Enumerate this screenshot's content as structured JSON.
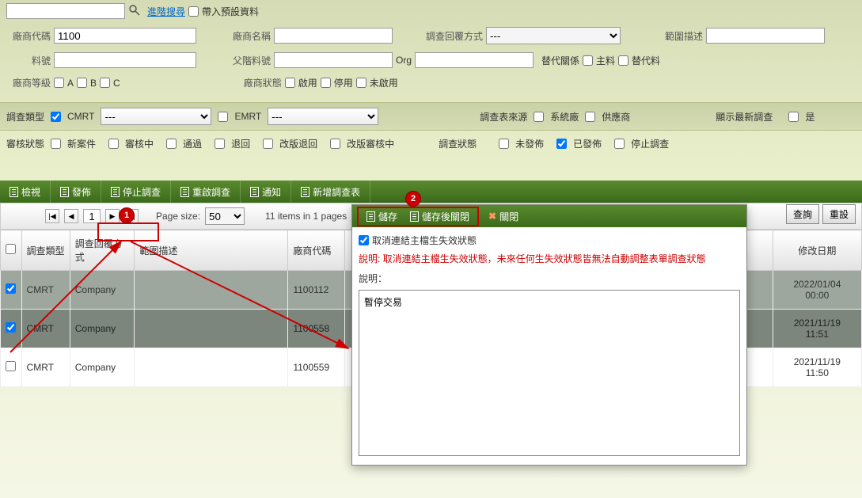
{
  "top": {
    "advanced_search": "進階搜尋",
    "preset_label": "帶入預設資料"
  },
  "form": {
    "vendor_code_lbl": "廠商代碼",
    "vendor_code_val": "1100",
    "vendor_name_lbl": "廠商名稱",
    "reply_method_lbl": "調查回覆方式",
    "reply_method_val": "---",
    "scope_desc_lbl": "範圍描述",
    "part_no_lbl": "料號",
    "parent_part_lbl": "父階料號",
    "org_lbl": "Org",
    "sub_rel_lbl": "替代關係",
    "main_part": "主料",
    "sub_part": "替代料",
    "vendor_grade_lbl": "廠商等級",
    "grade_a": "A",
    "grade_b": "B",
    "grade_c": "C",
    "vendor_status_lbl": "廠商狀態",
    "enable": "啟用",
    "disable": "停用",
    "not_enable": "未啟用"
  },
  "filter": {
    "survey_type_lbl": "調查類型",
    "cmrt": "CMRT",
    "emrt": "EMRT",
    "sel_placeholder": "---",
    "survey_source_lbl": "調查表來源",
    "sys_vendor": "系統廠",
    "supplier": "供應商",
    "show_latest_lbl": "顯示最新調查",
    "yes": "是"
  },
  "audit": {
    "audit_status_lbl": "審核狀態",
    "new_case": "新案件",
    "auditing": "審核中",
    "passed": "通過",
    "returned": "退回",
    "rev_return": "改版退回",
    "rev_audit": "改版審核中",
    "survey_status_lbl": "調查狀態",
    "unpublished": "未發佈",
    "published": "已發佈",
    "stopped": "停止調查"
  },
  "buttons": {
    "query": "查詢",
    "reset": "重設"
  },
  "toolbar": {
    "view": "檢視",
    "publish": "發佈",
    "stop": "停止調查",
    "restart": "重啟調查",
    "notify": "通知",
    "new_survey": "新增調查表"
  },
  "pager": {
    "page_val": "1",
    "page_size_lbl": "Page size:",
    "page_size_val": "50",
    "info": "11 items in 1 pages"
  },
  "grid": {
    "col_type": "調查類型",
    "col_reply": "調查回覆方式",
    "col_scope": "範圍描述",
    "col_vendor": "廠商代碼",
    "col_mod_date": "修改日期",
    "rows": [
      {
        "type": "CMRT",
        "reply": "Company",
        "vendor": "1100112",
        "date1": "2022/01/04",
        "date2": "00:00"
      },
      {
        "type": "CMRT",
        "reply": "Company",
        "vendor": "1100558",
        "date1": "2021/11/19",
        "date2": "11:51"
      },
      {
        "type": "CMRT",
        "reply": "Company",
        "vendor": "1100559",
        "date1": "2021/11/19",
        "date2": "11:50"
      }
    ]
  },
  "modal": {
    "save": "儲存",
    "save_close": "儲存後關閉",
    "close": "關閉",
    "cancel_link_lbl": "取消連結主檔生失效狀態",
    "warn": "說明: 取消連結主檔生失效狀態，未來任何生失效狀態皆無法自動調整表單調查狀態",
    "desc_lbl": "說明：",
    "desc_val": "暫停交易"
  },
  "badges": {
    "b1": "1",
    "b2": "2"
  }
}
